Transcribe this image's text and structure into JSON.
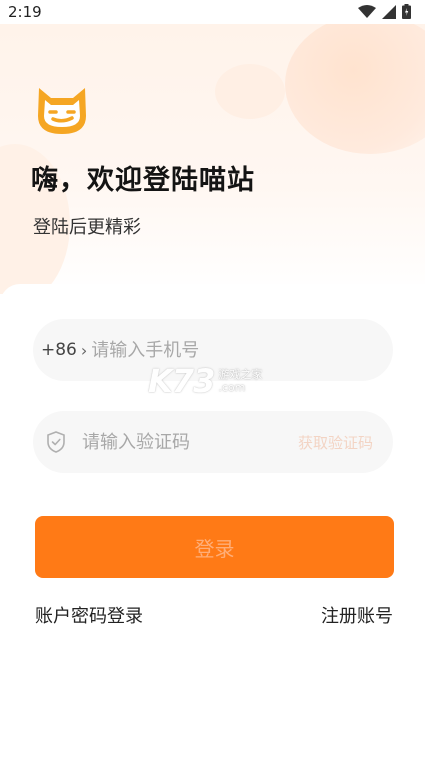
{
  "status_bar": {
    "time": "2:19"
  },
  "header": {
    "title": "嗨，欢迎登陆喵站",
    "subtitle": "登陆后更精彩",
    "logo_icon": "cat-face-logo"
  },
  "form": {
    "phone": {
      "prefix": "+86",
      "placeholder": "请输入手机号",
      "value": ""
    },
    "code": {
      "placeholder": "请输入验证码",
      "value": "",
      "get_code_label": "获取验证码"
    },
    "login_label": "登录",
    "password_login_label": "账户密码登录",
    "register_label": "注册账号"
  },
  "watermark": {
    "brand": "K73",
    "cn": "游戏之家",
    "domain": ".com"
  },
  "colors": {
    "accent": "#ff7a16",
    "logo": "#f5a623"
  }
}
